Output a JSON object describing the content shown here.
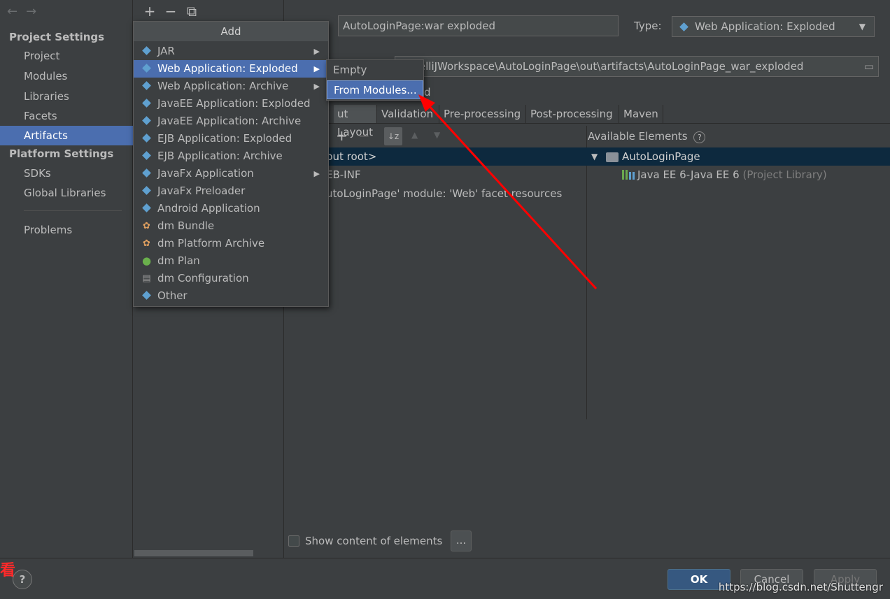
{
  "sidebar": {
    "project_settings_title": "Project Settings",
    "project_items": [
      "Project",
      "Modules",
      "Libraries",
      "Facets",
      "Artifacts"
    ],
    "selected_item": "Artifacts",
    "platform_settings_title": "Platform Settings",
    "platform_items": [
      "SDKs",
      "Global Libraries"
    ],
    "problems": "Problems"
  },
  "toolbar": {
    "add_glyph": "+",
    "remove_glyph": "−",
    "copy_glyph": "⧉"
  },
  "artifact": {
    "name": "AutoLoginPage:war exploded",
    "type_label": "Type:",
    "type_value": "Web Application: Exploded",
    "output_path": "telliJWorkspace\\AutoLoginPage\\out\\artifacts\\AutoLoginPage_war_exploded",
    "include_fragment": "d"
  },
  "tabs": [
    "ut Layout",
    "Validation",
    "Pre-processing",
    "Post-processing",
    "Maven"
  ],
  "layout_tree": [
    "put root>",
    "EB-INF",
    "utoLoginPage' module: 'Web' facet resources"
  ],
  "available": {
    "header": "Available Elements",
    "root": "AutoLoginPage",
    "library_name": "Java EE 6-Java EE 6",
    "library_suffix": "(Project Library)"
  },
  "popup": {
    "title": "Add",
    "items": [
      "JAR",
      "Web Application: Exploded",
      "Web Application: Archive",
      "JavaEE Application: Exploded",
      "JavaEE Application: Archive",
      "EJB Application: Exploded",
      "EJB Application: Archive",
      "JavaFx Application",
      "JavaFx Preloader",
      "Android Application",
      "dm Bundle",
      "dm Platform Archive",
      "dm Plan",
      "dm Configuration",
      "Other"
    ],
    "selected": "Web Application: Exploded"
  },
  "submenu": {
    "items": [
      "Empty",
      "From Modules..."
    ],
    "selected": "From Modules..."
  },
  "bottom": {
    "show_content_label": "Show content of elements",
    "ellipsis": "...",
    "ok": "OK",
    "cancel": "Cancel",
    "apply": "Apply",
    "help": "?",
    "watermark": "https://blog.csdn.net/Shuttengr",
    "red_glyph": "看"
  },
  "colors": {
    "selection": "#4b6eaf",
    "arrow": "#ff0000",
    "accent_blue": "#5fa0d0"
  }
}
